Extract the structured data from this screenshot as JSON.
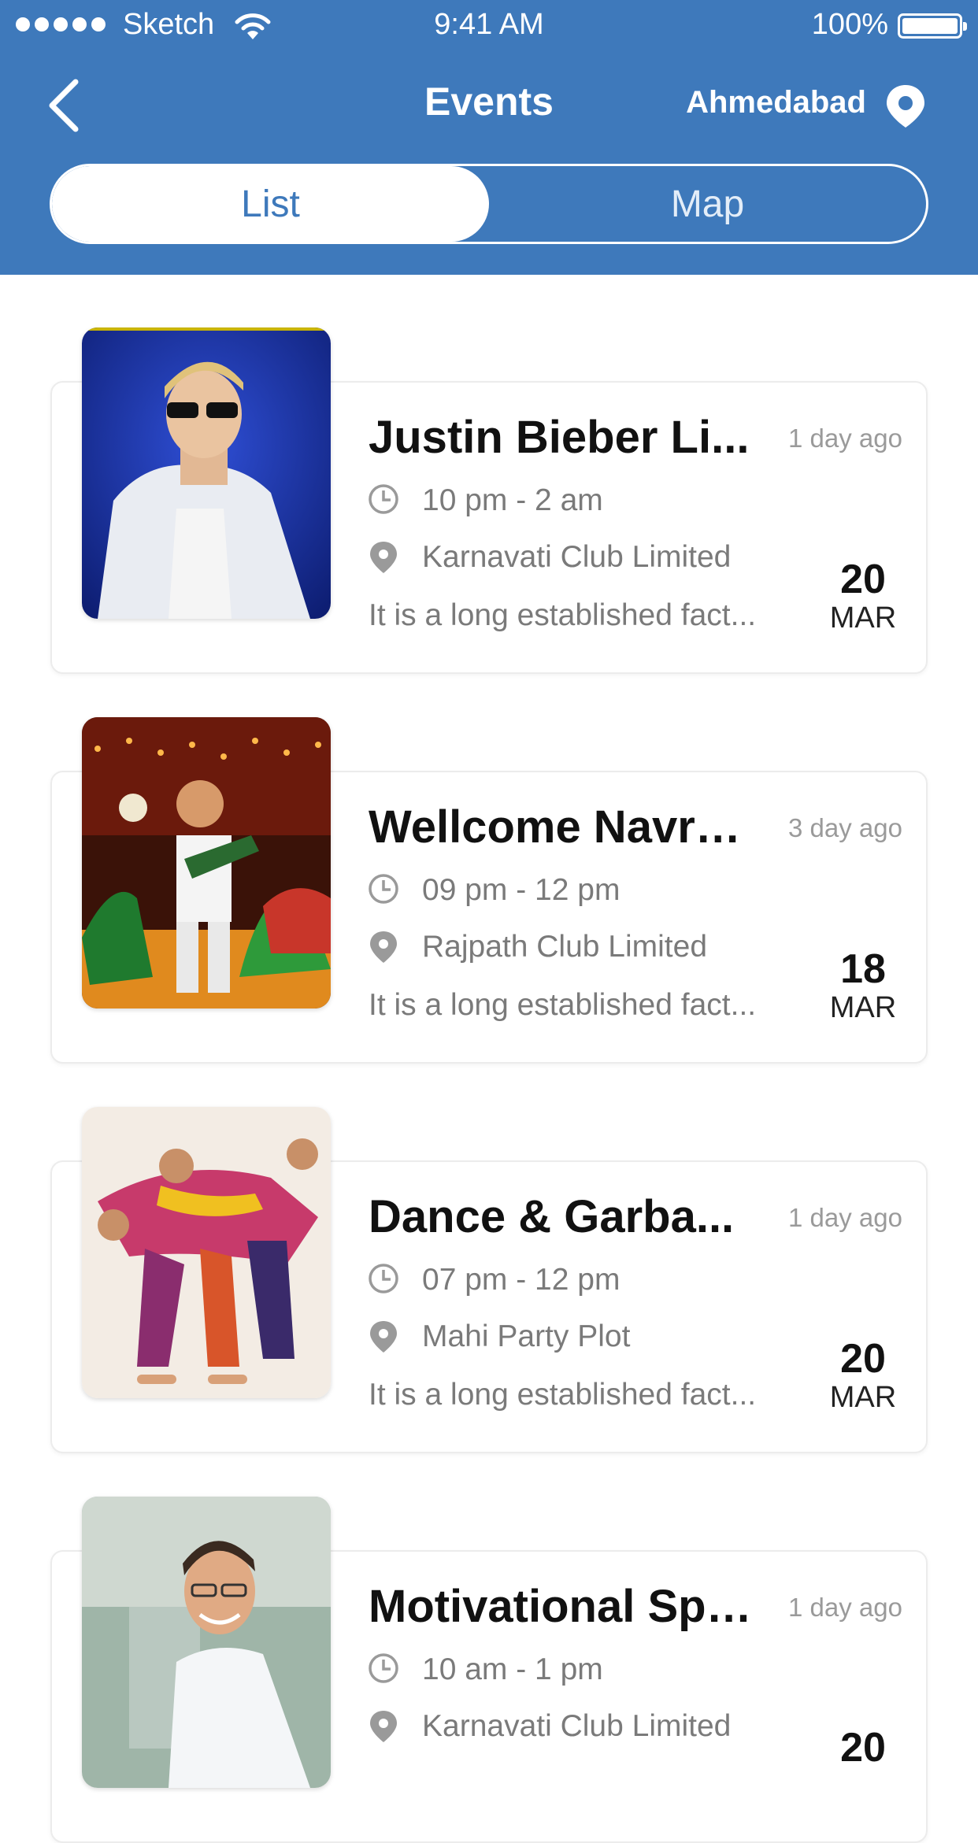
{
  "status_bar": {
    "carrier": "Sketch",
    "time": "9:41 AM",
    "battery": "100%"
  },
  "nav": {
    "title": "Events",
    "city": "Ahmedabad"
  },
  "tabs": [
    {
      "label": "List",
      "active": true
    },
    {
      "label": "Map",
      "active": false
    }
  ],
  "colors": {
    "primary": "#3e79bb"
  },
  "events": [
    {
      "title": "Justin Bieber Li...",
      "ago": "1 day ago",
      "time": "10 pm - 2 am",
      "place": "Karnavati Club Limited",
      "desc": "It is a long established fact...",
      "day": "20",
      "month": "MAR"
    },
    {
      "title": "Wellcome Navratri",
      "ago": "3 day ago",
      "time": "09 pm - 12 pm",
      "place": "Rajpath Club Limited",
      "desc": "It is a long established fact...",
      "day": "18",
      "month": "MAR"
    },
    {
      "title": "Dance & Garba...",
      "ago": "1 day ago",
      "time": "07 pm - 12 pm",
      "place": "Mahi Party Plot",
      "desc": "It is a long established fact...",
      "day": "20",
      "month": "MAR"
    },
    {
      "title": "Motivational Spe...",
      "ago": "1 day ago",
      "time": "10 am - 1 pm",
      "place": "Karnavati Club Limited",
      "desc": "",
      "day": "20",
      "month": ""
    }
  ]
}
